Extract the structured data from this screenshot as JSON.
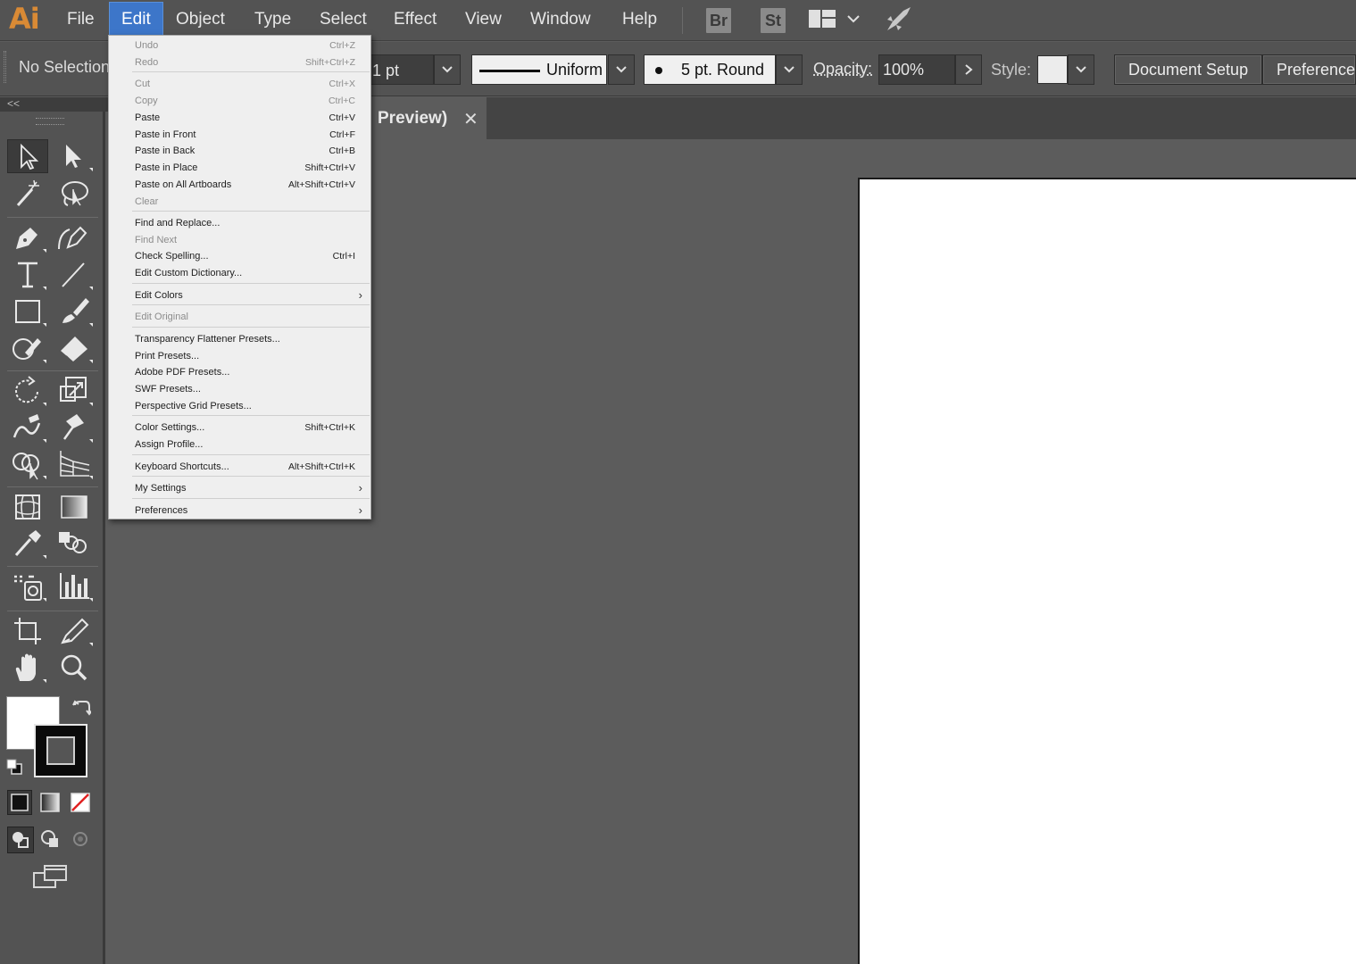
{
  "app": {
    "logo": "Ai"
  },
  "menubar": {
    "items": [
      "File",
      "Edit",
      "Object",
      "Type",
      "Select",
      "Effect",
      "View",
      "Window",
      "Help"
    ],
    "badges": [
      "Br",
      "St"
    ]
  },
  "controlbar": {
    "selection": "No Selection",
    "stroke_weight": "1 pt",
    "stroke_profile": "Uniform",
    "brush": "5 pt. Round",
    "opacity_label": "Opacity:",
    "opacity_value": "100%",
    "style_label": "Style:",
    "document_setup": "Document Setup",
    "preferences": "Preferences"
  },
  "tab": {
    "title": "Preview)",
    "close": "✕"
  },
  "panel": {
    "collapse": "<<"
  },
  "edit_menu": {
    "items": [
      {
        "label": "Undo",
        "shortcut": "Ctrl+Z",
        "disabled": true
      },
      {
        "label": "Redo",
        "shortcut": "Shift+Ctrl+Z",
        "disabled": true
      },
      {
        "label": "Cut",
        "shortcut": "Ctrl+X",
        "disabled": true
      },
      {
        "label": "Copy",
        "shortcut": "Ctrl+C",
        "disabled": true
      },
      {
        "label": "Paste",
        "shortcut": "Ctrl+V",
        "disabled": false
      },
      {
        "label": "Paste in Front",
        "shortcut": "Ctrl+F",
        "disabled": false
      },
      {
        "label": "Paste in Back",
        "shortcut": "Ctrl+B",
        "disabled": false
      },
      {
        "label": "Paste in Place",
        "shortcut": "Shift+Ctrl+V",
        "disabled": false
      },
      {
        "label": "Paste on All Artboards",
        "shortcut": "Alt+Shift+Ctrl+V",
        "disabled": false
      },
      {
        "label": "Clear",
        "shortcut": "",
        "disabled": true
      },
      {
        "label": "Find and Replace...",
        "shortcut": "",
        "disabled": false
      },
      {
        "label": "Find Next",
        "shortcut": "",
        "disabled": true
      },
      {
        "label": "Check Spelling...",
        "shortcut": "Ctrl+I",
        "disabled": false
      },
      {
        "label": "Edit Custom Dictionary...",
        "shortcut": "",
        "disabled": false
      },
      {
        "label": "Edit Colors",
        "shortcut": "",
        "disabled": false,
        "submenu": true
      },
      {
        "label": "Edit Original",
        "shortcut": "",
        "disabled": true
      },
      {
        "label": "Transparency Flattener Presets...",
        "shortcut": "",
        "disabled": false
      },
      {
        "label": "Print Presets...",
        "shortcut": "",
        "disabled": false
      },
      {
        "label": "Adobe PDF Presets...",
        "shortcut": "",
        "disabled": false
      },
      {
        "label": "SWF Presets...",
        "shortcut": "",
        "disabled": false
      },
      {
        "label": "Perspective Grid Presets...",
        "shortcut": "",
        "disabled": false
      },
      {
        "label": "Color Settings...",
        "shortcut": "Shift+Ctrl+K",
        "disabled": false
      },
      {
        "label": "Assign Profile...",
        "shortcut": "",
        "disabled": false
      },
      {
        "label": "Keyboard Shortcuts...",
        "shortcut": "Alt+Shift+Ctrl+K",
        "disabled": false
      },
      {
        "label": "My Settings",
        "shortcut": "",
        "disabled": false,
        "submenu": true
      },
      {
        "label": "Preferences",
        "shortcut": "",
        "disabled": false,
        "submenu": true
      }
    ]
  },
  "colors": {
    "accent": "#3d76c9",
    "logo": "#d98a35",
    "chrome": "#535353",
    "canvas": "#5c5c5c"
  }
}
